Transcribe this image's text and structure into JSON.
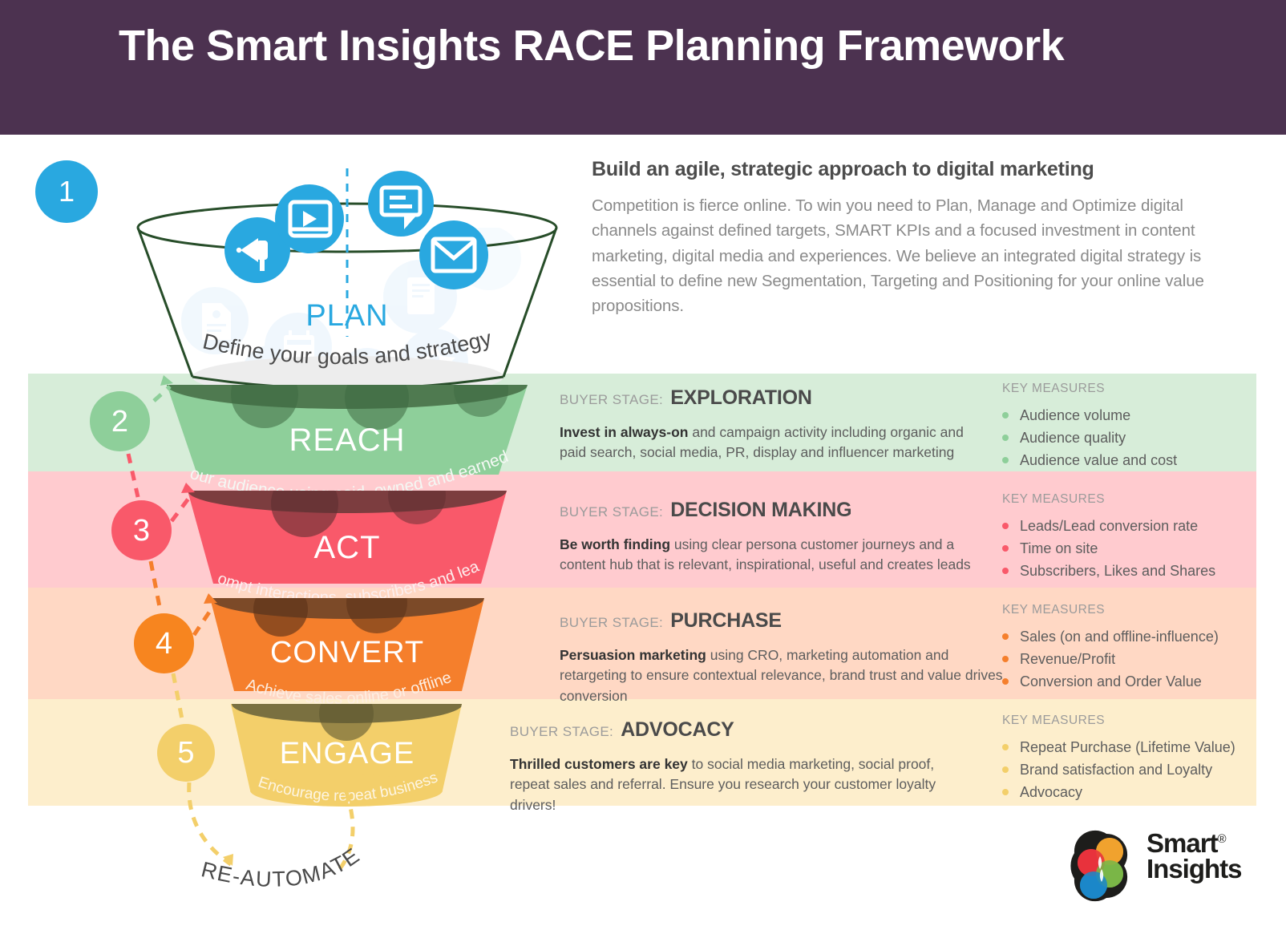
{
  "header": {
    "title": "The Smart Insights RACE Planning Framework",
    "bg_color": "#4c3250"
  },
  "intro": {
    "heading": "Build an agile, strategic approach to digital marketing",
    "body": "Competition is fierce online. To win you need to Plan, Manage and Optimize digital channels against defined targets, SMART KPIs and a focused investment in content marketing, digital media and experiences. We believe an integrated digital strategy is essential to define new Segmentation, Targeting and Positioning for your online value propositions."
  },
  "funnel": {
    "plan": {
      "step": "1",
      "name": "PLAN",
      "subtitle": "Define your goals and strategy",
      "color": "#29a8e0",
      "icons": [
        "megaphone-icon",
        "video-player-icon",
        "chat-bubble-icon",
        "envelope-icon",
        "document-icon",
        "mobile-icon",
        "calendar-icon",
        "folder-icon",
        "badge-icon",
        "contact-card-icon"
      ]
    },
    "stages": [
      {
        "step": "2",
        "name": "REACH",
        "subtitle": "Grow your audience using paid, owned and earned media",
        "color": "#8ecf9a",
        "top_color": "#4f7a50",
        "band_color": "#d7edd9"
      },
      {
        "step": "3",
        "name": "ACT",
        "subtitle": "Prompt interactions, subscribers and leads",
        "color": "#f9596a",
        "top_color": "#7c3d3f",
        "band_color": "#ffcbcf"
      },
      {
        "step": "4",
        "name": "CONVERT",
        "subtitle": "Achieve sales online or offline",
        "color": "#f57f2c",
        "top_color": "#7c4a28",
        "band_color": "#ffd8c4"
      },
      {
        "step": "5",
        "name": "ENGAGE",
        "subtitle": "Encourage repeat business",
        "color": "#f3cf6a",
        "top_color": "#7a7040",
        "band_color": "#fdeecc"
      }
    ],
    "loop_label": "RE-AUTOMATE"
  },
  "rows": [
    {
      "stage_prefix": "BUYER STAGE:",
      "stage_name": "EXPLORATION",
      "desc_bold": "Invest in always-on",
      "desc_rest": " and campaign activity including organic and paid search, social media, PR, display and influencer marketing",
      "measures_title": "KEY MEASURES",
      "measures": [
        "Audience volume",
        "Audience quality",
        "Audience value and cost"
      ],
      "dot_color": "#8ecf9a"
    },
    {
      "stage_prefix": "BUYER STAGE:",
      "stage_name": "DECISION MAKING",
      "desc_bold": "Be worth finding",
      "desc_rest": " using clear persona customer journeys and a content hub that is relevant, inspirational, useful and creates leads",
      "measures_title": "KEY MEASURES",
      "measures": [
        "Leads/Lead conversion rate",
        "Time on site",
        "Subscribers, Likes and Shares"
      ],
      "dot_color": "#f9596a"
    },
    {
      "stage_prefix": "BUYER STAGE:",
      "stage_name": "PURCHASE",
      "desc_bold": "Persuasion marketing",
      "desc_rest": " using CRO, marketing automation and retargeting to ensure contextual relevance, brand trust and value drives conversion",
      "measures_title": "KEY MEASURES",
      "measures": [
        "Sales (on and offline-influence)",
        "Revenue/Profit",
        "Conversion and Order Value"
      ],
      "dot_color": "#f57f2c"
    },
    {
      "stage_prefix": "BUYER STAGE:",
      "stage_name": "ADVOCACY",
      "desc_bold": "Thrilled customers are key",
      "desc_rest": " to social media marketing, social proof, repeat sales and referral. Ensure you research your customer loyalty drivers!",
      "measures_title": "KEY MEASURES",
      "measures": [
        "Repeat Purchase (Lifetime Value)",
        "Brand satisfaction and Loyalty",
        "Advocacy"
      ],
      "dot_color": "#f3cf6a"
    }
  ],
  "logo": {
    "line1": "Smart",
    "line2": "Insights",
    "registered": "®",
    "circle_colors": [
      "#f0a22e",
      "#e8323c",
      "#7ab648",
      "#1b87c9"
    ]
  }
}
